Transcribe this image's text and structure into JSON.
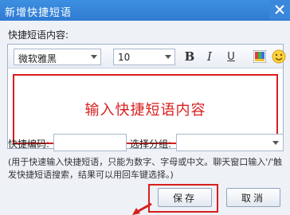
{
  "window": {
    "title": "新增快捷短语",
    "close_icon": "close-icon"
  },
  "editor": {
    "section_label": "快捷短语内容:",
    "font_family_value": "微软雅黑",
    "font_size_value": "10",
    "bold_label": "B",
    "italic_label": "I",
    "underline_label": "U",
    "color_icon": "color-palette-icon",
    "emoji_icon": "smiley-icon",
    "content_hint": "输入快捷短语内容",
    "highlight_color": "#d81e1e"
  },
  "form": {
    "code_label": "快捷编码:",
    "code_value": "",
    "group_label": "选择分组:",
    "group_value": ""
  },
  "help": {
    "text": "(用于快速输入快捷短语，只能为数字、字母或中文。聊天窗口输入'/'触发快捷短语搜索，结果可以用回车键选择。)"
  },
  "buttons": {
    "save_label": "保存",
    "cancel_label": "取消"
  },
  "colors": {
    "titlebar": "#2f7bd2",
    "annotation": "#d81e1e"
  }
}
